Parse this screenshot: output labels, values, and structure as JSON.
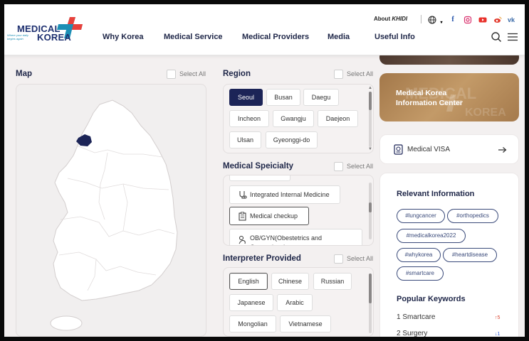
{
  "logo": {
    "line1": "MEDICAL",
    "line2": "KOREA",
    "tagline": "Where your daily begins again"
  },
  "nav": [
    "Why Korea",
    "Medical Service",
    "Medical Providers",
    "Media",
    "Useful Info"
  ],
  "toplinks": {
    "about": "About",
    "brand": "KHIDI"
  },
  "colors": {
    "navy": "#1c2457",
    "accent_red": "#e8413b",
    "accent_teal": "#1d8fb5",
    "gold": "#b88a4e"
  },
  "map": {
    "title": "Map",
    "select_all": "Select All"
  },
  "region": {
    "title": "Region",
    "select_all": "Select All",
    "items": [
      "Seoul",
      "Busan",
      "Daegu",
      "Incheon",
      "Gwangju",
      "Daejeon",
      "Ulsan",
      "Gyeonggi-do"
    ],
    "active": "Seoul"
  },
  "specialty": {
    "title": "Medical Speicialty",
    "select_all": "Select All",
    "items": [
      "Integrated Internal Medicine",
      "Medical checkup",
      "OB/GYN(Obestetrics and Gynecology)"
    ]
  },
  "interpreter": {
    "title": "Interpreter Provided",
    "select_all": "Select All",
    "items": [
      "English",
      "Chinese",
      "Russian",
      "Japanese",
      "Arabic",
      "Mongolian",
      "Vietnamese"
    ]
  },
  "side": {
    "info_center": "Medical Korea Information Center",
    "visa": "Medical VISA",
    "relevant_title": "Relevant Information",
    "tags": [
      "#lungcancer",
      "#orthopedics",
      "#medicalkorea2022",
      "#whykorea",
      "#heartdisease",
      "#smartcare"
    ],
    "popular_title": "Popular Keywords",
    "keywords": [
      {
        "label": "1 Smartcare",
        "change": "↑5"
      },
      {
        "label": "2 Surgery",
        "change": "↓1"
      }
    ]
  }
}
